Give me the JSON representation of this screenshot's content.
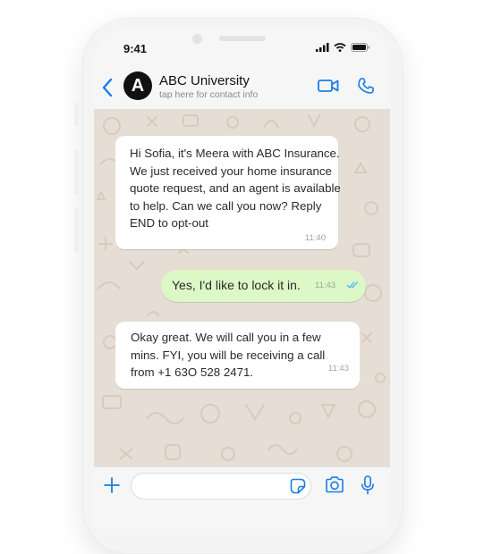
{
  "status_bar": {
    "time": "9:41"
  },
  "header": {
    "avatar_letter": "A",
    "contact_name": "ABC University",
    "contact_subtitle": "tap here for contact info",
    "icons": [
      "chevron-left-icon",
      "video-call-icon",
      "phone-icon"
    ]
  },
  "messages": [
    {
      "direction": "incoming",
      "text": "Hi Sofia, it's Meera with ABC Insurance. We just received your home insurance quote request, and an agent is available to help. Can we call you now? Reply END to opt-out",
      "time": "11:40"
    },
    {
      "direction": "outgoing",
      "text": "Yes, I'd like to lock it in.",
      "time": "11:43",
      "read": true
    },
    {
      "direction": "incoming",
      "text": "Okay great. We will call you in a few mins. FYI, you will be receiving a call from +1 63O 528 2471.",
      "time": "11:43"
    }
  ],
  "input_bar": {
    "icons": [
      "plus-icon",
      "sticker-icon",
      "camera-icon",
      "microphone-icon"
    ]
  },
  "colors": {
    "accent": "#1a7de6",
    "chat_background": "#e6ddd4",
    "outgoing_bubble": "#dcf8c6",
    "incoming_bubble": "#ffffff"
  }
}
